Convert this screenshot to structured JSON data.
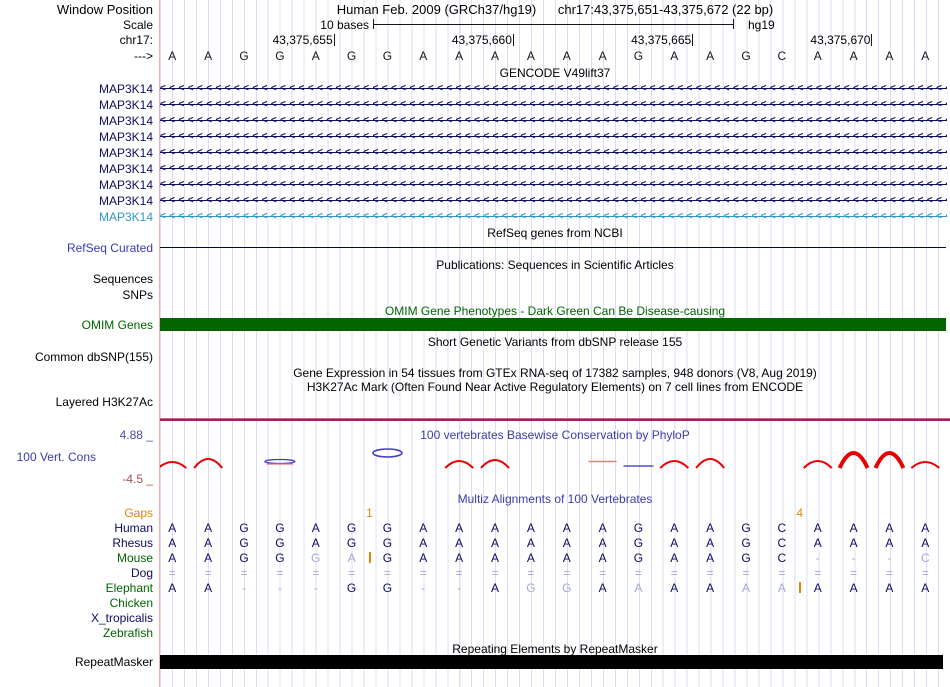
{
  "colors": {
    "navy": "#0C0C62",
    "teal_transcript": "#2E96C8",
    "refseq_blue": "#3A3AB4",
    "dark_green": "#006400",
    "title_blue": "#3B3BAE",
    "orange": "#E18800",
    "pale_base": "#A3A8D6",
    "red_arc": "#E80000",
    "blue_arc": "#4040C0",
    "h3k27ac_line": "#93295B",
    "gridline": "#DCDCF2",
    "edge_line_pink": "#FFAAAA",
    "omim_bar": "#006400",
    "repeat_bar": "#000000"
  },
  "header": {
    "window_position_label": "Window Position",
    "assembly_title": "Human Feb. 2009 (GRCh37/hg19)",
    "position_title": "chr17:43,375,651-43,375,672 (22 bp)",
    "scale_label": "Scale",
    "scale_text": "10 bases",
    "assembly_short": "hg19",
    "chrom_label": "chr17:",
    "strand_label": "--->",
    "coordinate_ticks": [
      {
        "label": "43,375,655",
        "col": 5
      },
      {
        "label": "43,375,660",
        "col": 10
      },
      {
        "label": "43,375,665",
        "col": 15
      },
      {
        "label": "43,375,670",
        "col": 20
      }
    ]
  },
  "sequence": [
    "A",
    "A",
    "G",
    "G",
    "A",
    "G",
    "G",
    "A",
    "A",
    "A",
    "A",
    "A",
    "A",
    "G",
    "A",
    "A",
    "G",
    "C",
    "A",
    "A",
    "A",
    "A"
  ],
  "gencode": {
    "title": "GENCODE V49lift37",
    "strand_char": "<",
    "transcripts": [
      {
        "label": "MAP3K14",
        "color": "#0C0C62"
      },
      {
        "label": "MAP3K14",
        "color": "#0C0C62"
      },
      {
        "label": "MAP3K14",
        "color": "#0C0C62"
      },
      {
        "label": "MAP3K14",
        "color": "#0C0C62"
      },
      {
        "label": "MAP3K14",
        "color": "#0C0C62"
      },
      {
        "label": "MAP3K14",
        "color": "#0C0C62"
      },
      {
        "label": "MAP3K14",
        "color": "#0C0C62"
      },
      {
        "label": "MAP3K14",
        "color": "#0C0C62"
      },
      {
        "label": "MAP3K14",
        "color": "#2E96C8"
      }
    ]
  },
  "refseq": {
    "title": "RefSeq genes from NCBI",
    "label": "RefSeq Curated"
  },
  "publications": {
    "title": "Publications: Sequences in Scientific Articles"
  },
  "sequences_track": {
    "label": "Sequences"
  },
  "snps_track": {
    "label": "SNPs"
  },
  "omim": {
    "title": "OMIM Gene Phenotypes - Dark Green Can Be Disease-causing",
    "label": "OMIM Genes"
  },
  "dbsnp": {
    "title": "Short Genetic Variants from dbSNP release 155",
    "label": "Common dbSNP(155)"
  },
  "gtex": {
    "title": "Gene Expression in 54 tissues from GTEx RNA-seq of 17382 samples, 948 donors (V8, Aug 2019)"
  },
  "h3k27ac": {
    "title": "H3K27Ac Mark (Often Found Near Active Regulatory Elements) on 7 cell lines from ENCODE",
    "label": "Layered H3K27Ac"
  },
  "phylop": {
    "title": "100 vertebrates Basewise Conservation by PhyloP",
    "label": "100 Vert. Cons",
    "max_label": "4.88 _",
    "min_label": "-4.5 _",
    "shapes": [
      {
        "col": 1,
        "kind": "arc",
        "size": 6
      },
      {
        "col": 2,
        "kind": "arc",
        "size": 9
      },
      {
        "col": 4,
        "kind": "flatlens",
        "size": 2
      },
      {
        "col": 7,
        "kind": "lens",
        "size": 4
      },
      {
        "col": 9,
        "kind": "arc",
        "size": 7
      },
      {
        "col": 10,
        "kind": "arc",
        "size": 8
      },
      {
        "col": 13,
        "kind": "redline",
        "size": 1
      },
      {
        "col": 14,
        "kind": "blueline",
        "size": 1
      },
      {
        "col": 15,
        "kind": "arc",
        "size": 7
      },
      {
        "col": 16,
        "kind": "arc",
        "size": 9
      },
      {
        "col": 19,
        "kind": "arc",
        "size": 7
      },
      {
        "col": 20,
        "kind": "bigarc",
        "size": 15
      },
      {
        "col": 21,
        "kind": "bigarc",
        "size": 15
      },
      {
        "col": 22,
        "kind": "arc",
        "size": 6
      }
    ]
  },
  "multiz": {
    "title": "Multiz Alignments of 100 Vertebrates",
    "gaps_label": "Gaps",
    "gap_markers": [
      {
        "text": "1",
        "after_col": 6
      },
      {
        "text": "4",
        "after_col": 18
      }
    ],
    "rows": [
      {
        "label": "Human",
        "color": "#0C0C62",
        "cells": [
          "A",
          "A",
          "G",
          "G",
          "A",
          "G",
          "G",
          "A",
          "A",
          "A",
          "A",
          "A",
          "A",
          "G",
          "A",
          "A",
          "G",
          "C",
          "A",
          "A",
          "A",
          "A"
        ],
        "pale": []
      },
      {
        "label": "Rhesus",
        "color": "#0C0C62",
        "cells": [
          "A",
          "A",
          "G",
          "G",
          "A",
          "G",
          "G",
          "A",
          "A",
          "A",
          "A",
          "A",
          "A",
          "G",
          "A",
          "A",
          "G",
          "C",
          "A",
          "A",
          "A",
          "A"
        ],
        "pale": []
      },
      {
        "label": "Mouse",
        "color": "#006400",
        "cells": [
          "A",
          "A",
          "G",
          "G",
          "G",
          "A",
          "G",
          "A",
          "A",
          "A",
          "A",
          "A",
          "A",
          "G",
          "A",
          "A",
          "G",
          "C",
          "-",
          "-",
          "-",
          "C"
        ],
        "pale": [
          5,
          6,
          22
        ],
        "insert_after_col": 6
      },
      {
        "label": "Dog",
        "color": "#0C0C62",
        "cells": [
          "=",
          "=",
          "=",
          "=",
          "=",
          "=",
          "=",
          "=",
          "=",
          "=",
          "=",
          "=",
          "=",
          "=",
          "=",
          "=",
          "=",
          "=",
          "=",
          "=",
          "=",
          "="
        ],
        "pale": []
      },
      {
        "label": "Elephant",
        "color": "#006400",
        "cells": [
          "A",
          "A",
          "-",
          "-",
          "-",
          "G",
          "G",
          "-",
          "-",
          "A",
          "G",
          "G",
          "A",
          "A",
          "A",
          "A",
          "A",
          "A",
          "A",
          "A",
          "A",
          "A"
        ],
        "pale": [
          11,
          12,
          14,
          17,
          18
        ],
        "insert_after_col": 18
      },
      {
        "label": "Chicken",
        "color": "#006400",
        "cells": [],
        "pale": []
      },
      {
        "label": "X_tropicalis",
        "color": "#0C0C62",
        "cells": [],
        "pale": []
      },
      {
        "label": "Zebrafish",
        "color": "#006400",
        "cells": [],
        "pale": []
      }
    ]
  },
  "repeatmasker": {
    "title": "Repeating Elements by RepeatMasker",
    "label": "RepeatMasker"
  }
}
